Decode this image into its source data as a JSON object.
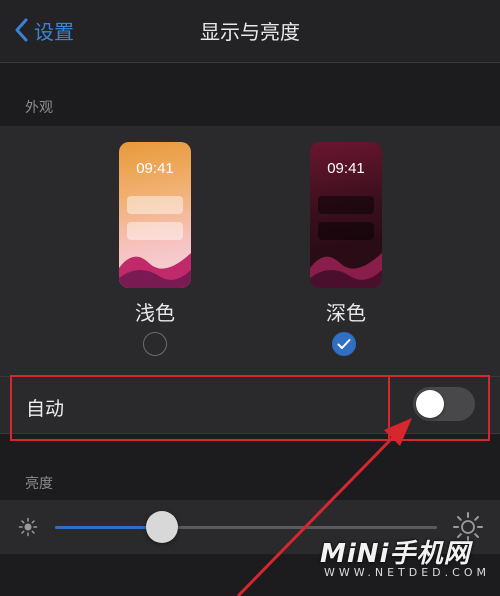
{
  "nav": {
    "back_label": "设置",
    "title": "显示与亮度"
  },
  "appearance": {
    "section_label": "外观",
    "options": [
      {
        "label": "浅色",
        "time": "09:41",
        "selected": false
      },
      {
        "label": "深色",
        "time": "09:41",
        "selected": true
      }
    ]
  },
  "auto": {
    "label": "自动",
    "toggle_on": false
  },
  "brightness": {
    "section_label": "亮度",
    "level": 0.28
  },
  "watermark": {
    "brand": "MiNi手机网",
    "domain": "WWW.NETDED.COM"
  },
  "colors": {
    "accent": "#2f6fc4",
    "highlight": "#d6262e"
  }
}
